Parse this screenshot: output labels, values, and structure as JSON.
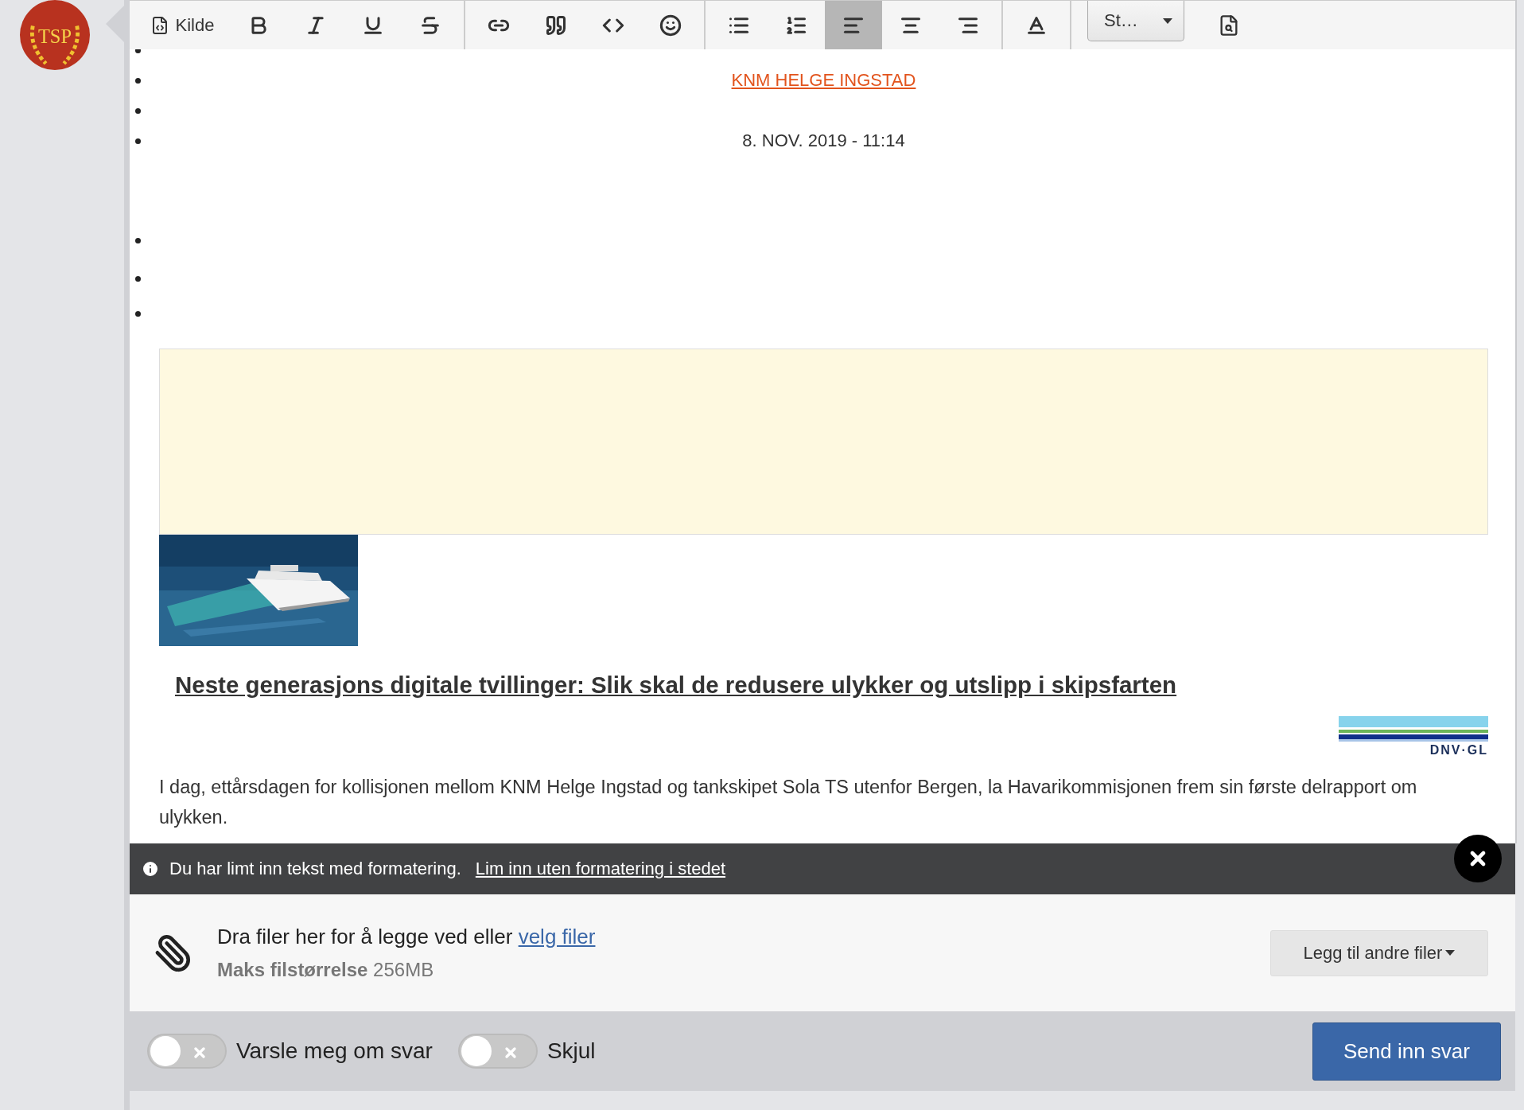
{
  "logo": {
    "text": "TSP"
  },
  "toolbar": {
    "groups": [
      [
        {
          "kind": "source",
          "label": "Kilde",
          "selected": false
        },
        {
          "kind": "bold",
          "selected": false
        },
        {
          "kind": "italic",
          "selected": false
        },
        {
          "kind": "underline",
          "selected": false
        },
        {
          "kind": "strike",
          "selected": false
        }
      ],
      [
        {
          "kind": "link",
          "selected": false
        },
        {
          "kind": "quote",
          "selected": false
        },
        {
          "kind": "code",
          "selected": false
        },
        {
          "kind": "emoji",
          "selected": false
        }
      ],
      [
        {
          "kind": "bullets",
          "selected": false
        },
        {
          "kind": "numbers",
          "selected": false
        },
        {
          "kind": "align-left",
          "selected": true
        },
        {
          "kind": "align-center",
          "selected": false
        },
        {
          "kind": "align-right",
          "selected": false
        }
      ],
      [
        {
          "kind": "text-color",
          "selected": false
        }
      ]
    ],
    "styles": {
      "label": "St…"
    },
    "preview": {
      "kind": "preview"
    }
  },
  "list_items": [
    {
      "kind": "empty"
    },
    {
      "kind": "link",
      "text": "KNM HELGE INGSTAD"
    },
    {
      "kind": "empty"
    },
    {
      "kind": "date",
      "text": "8. NOV. 2019 - 11:14"
    },
    {
      "kind": "empty"
    },
    {
      "kind": "empty"
    },
    {
      "kind": "empty"
    }
  ],
  "ad_box": {
    "kind": "empty-box"
  },
  "article": {
    "title": "Neste generasjons digitale tvillinger: Slik skal de redusere ulykker og utslipp i skipsfarten",
    "sponsor_logo": {
      "text": "DNV·GL"
    },
    "paragraph": "I dag, ettårsdagen for kollisjonen mellom KNM Helge Ingstad og tankskipet Sola TS utenfor Bergen, la Havarikommisjonen frem sin første delrapport om ulykken."
  },
  "notice": {
    "text": "Du har limt inn tekst med formatering.",
    "link": "Lim inn uten formatering i stedet"
  },
  "attachments": {
    "text": "Dra filer her for å legge ved eller",
    "link": "velg filer",
    "size_label": "Maks filstørrelse",
    "size_value": "256MB",
    "button": "Legg til andre filer"
  },
  "toggles": [
    {
      "label": "Varsle meg om svar",
      "on": false
    },
    {
      "label": "Skjul",
      "on": false
    }
  ],
  "submit": "Send inn svar"
}
